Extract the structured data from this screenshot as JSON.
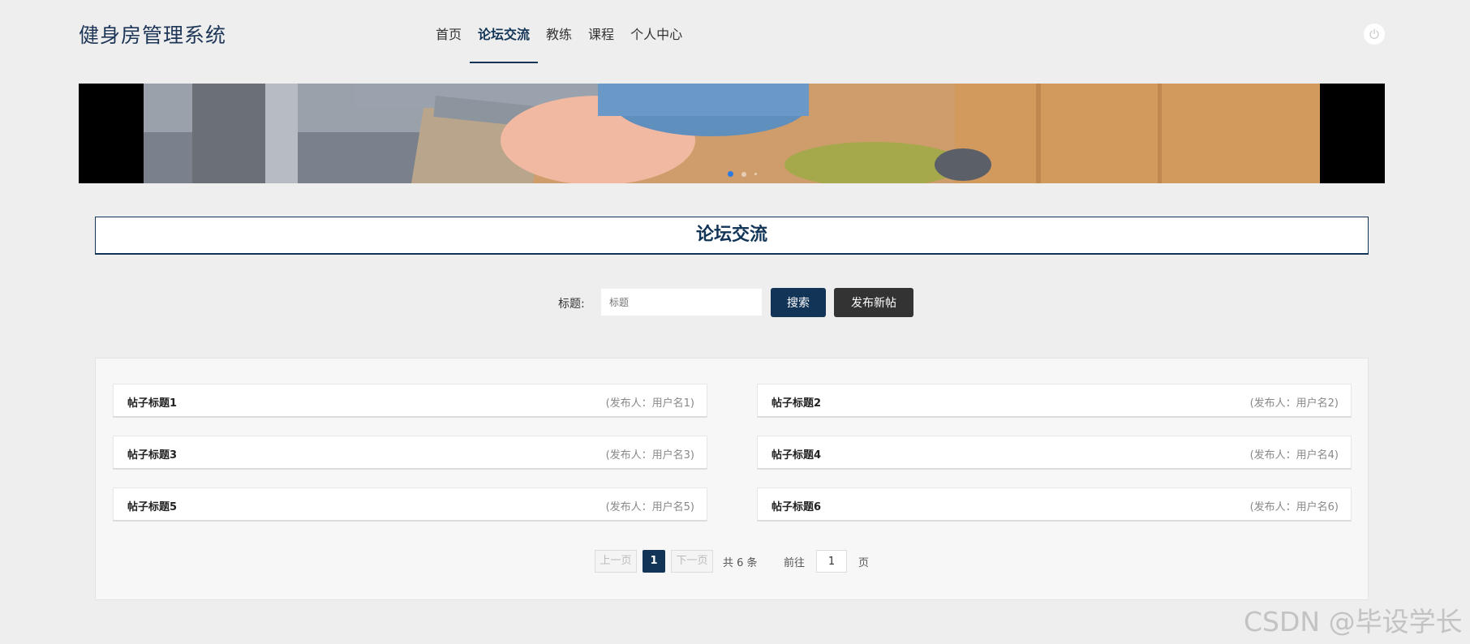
{
  "header": {
    "site_title": "健身房管理系统",
    "nav": [
      {
        "label": "首页",
        "active": false
      },
      {
        "label": "论坛交流",
        "active": true
      },
      {
        "label": "教练",
        "active": false
      },
      {
        "label": "课程",
        "active": false
      },
      {
        "label": "个人中心",
        "active": false
      }
    ]
  },
  "banner": {
    "slide_count": 3,
    "active_index": 0
  },
  "section": {
    "title": "论坛交流"
  },
  "search": {
    "label": "标题:",
    "placeholder": "标题",
    "search_button": "搜索",
    "post_button": "发布新帖"
  },
  "posts": [
    {
      "title": "帖子标题1",
      "author": "(发布人：用户名1)"
    },
    {
      "title": "帖子标题2",
      "author": "(发布人：用户名2)"
    },
    {
      "title": "帖子标题3",
      "author": "(发布人：用户名3)"
    },
    {
      "title": "帖子标题4",
      "author": "(发布人：用户名4)"
    },
    {
      "title": "帖子标题5",
      "author": "(发布人：用户名5)"
    },
    {
      "title": "帖子标题6",
      "author": "(发布人：用户名6)"
    }
  ],
  "pagination": {
    "prev": "上一页",
    "next": "下一页",
    "current": "1",
    "total": "共 6 条",
    "goto": "前往",
    "goto_value": "1",
    "page_suffix": "页"
  },
  "watermark": "CSDN @毕设学长",
  "colors": {
    "primary": "#123456",
    "dark_button": "#333333",
    "background": "#eeeeee"
  }
}
